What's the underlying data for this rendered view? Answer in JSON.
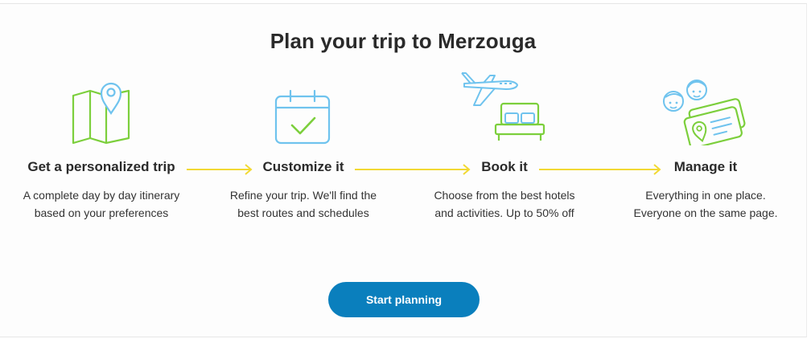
{
  "title": "Plan your trip to Merzouga",
  "steps": [
    {
      "title": "Get a personalized trip",
      "desc_line1": "A complete day by day itinerary",
      "desc_line2": "based on your preferences",
      "icon": "map-pin-icon"
    },
    {
      "title": "Customize it",
      "desc_line1": "Refine your trip. We'll find the",
      "desc_line2": "best routes and schedules",
      "icon": "calendar-check-icon"
    },
    {
      "title": "Book it",
      "desc_line1": "Choose from the best hotels",
      "desc_line2": "and activities. Up to 50% off",
      "icon": "plane-bed-icon"
    },
    {
      "title": "Manage it",
      "desc_line1": "Everything in one place.",
      "desc_line2": "Everyone on the same page.",
      "icon": "travelers-tickets-icon"
    }
  ],
  "cta": {
    "label": "Start planning"
  },
  "colors": {
    "green": "#7ccf3c",
    "blue": "#6fc3ee",
    "arrow": "#f2d933",
    "button": "#0a7fbd"
  }
}
